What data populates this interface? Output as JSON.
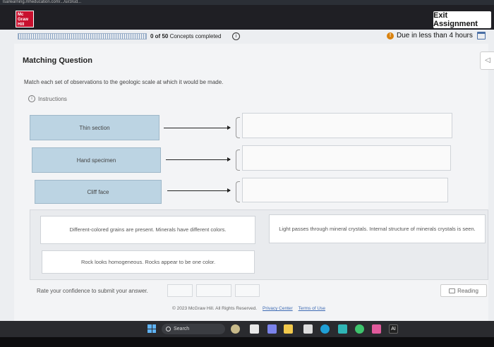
{
  "browser": {
    "url_fragment": "lsa/learning.mheducation.com/.../ui/3/ud..."
  },
  "header": {
    "logo_text": "Mc Graw Hill",
    "exit_label": "Exit Assignment"
  },
  "progress": {
    "completed_text": "0 of 50",
    "suffix": "Concepts completed",
    "info_symbol": "i",
    "fraction": 0.0
  },
  "due": {
    "icon_symbol": "!",
    "text": "Due in less than 4 hours"
  },
  "question": {
    "title": "Matching Question",
    "prompt": "Match each set of observations to the geologic scale at which it would be made.",
    "instructions_label": "Instructions",
    "terms": [
      "Thin section",
      "Hand specimen",
      "Cliff face"
    ],
    "choices": [
      "Different-colored grains are present. Minerals have different colors.",
      "Light passes through mineral crystals. Internal structure of minerals crystals is seen.",
      "Rock looks homogeneous. Rocks appear to be one color."
    ]
  },
  "confidence": {
    "label": "Rate your confidence to submit your answer."
  },
  "reading": {
    "label": "Reading",
    "icon": "book-icon"
  },
  "footer": {
    "copyright": "© 2023 McGraw Hill. All Rights Reserved.",
    "privacy": "Privacy Center",
    "terms": "Terms of Use"
  },
  "taskbar": {
    "search_label": "Search"
  },
  "colors": {
    "accent": "#c8102e",
    "term_bg": "#bcd4e3",
    "due": "#d9820f"
  }
}
